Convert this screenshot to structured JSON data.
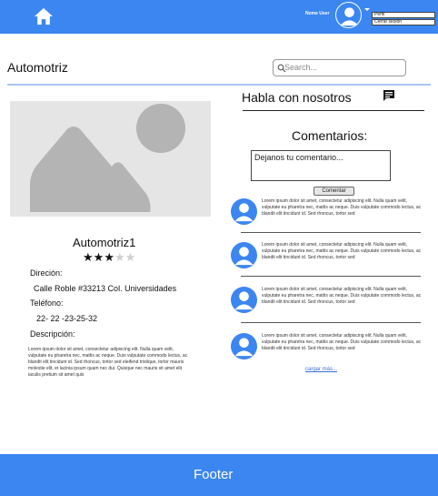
{
  "header": {
    "home_icon": "home-icon",
    "user_name": "Nome User",
    "avatar_icon": "person-icon",
    "menu": [
      "Perfil",
      "Cerrar sesión"
    ],
    "color": "#3b86f0"
  },
  "page": {
    "title": "Automotriz",
    "search_placeholder": "Search..."
  },
  "business": {
    "image_icon": "image-placeholder-icon",
    "name": "Automotriz1",
    "stars_filled": 3,
    "stars_total": 5,
    "rating_stars": "★★★★★",
    "address_label": "Direción:",
    "address": "Calle Roble #33213 Col. Universidades",
    "phone_label": "Teléfono:",
    "phone": "22- 22 -23-25-32",
    "description_label": "Descripción:",
    "description": "Lorem ipsum dolor sit amet, consectetur adipiscing elit. Nulla quam velit, vulputate eu pharetra nec, mattis ac neque. Duis vulputate commodo lectus, ac blandit elit tincidunt id. Sed rhoncus, tortor sed eleifend tristique, tortor mauris molestie elit, et lacinia ipsum quam nec dui. Quisque nec mauris sit amet elit iaculis pretium sit amet quis"
  },
  "chat": {
    "title": "Habla con nosotros",
    "icon": "chat-icon"
  },
  "comments": {
    "title": "Comentarios:",
    "input_value": "Dejanos tu comentario...",
    "button": "Comentar",
    "items": [
      {
        "text": "Lorem ipsum dolor sit amet, consectetur adipiscing elit. Nulla quam velit, vulputate eu pharetra nec, mattis ac neque. Duis vulputate commodo lectus, ac blandit elit tincidunt id. Sed rhoncus, tortor sed"
      },
      {
        "text": "Lorem ipsum dolor sit amet, consectetur adipiscing elit. Nulla quam velit, vulputate eu pharetra nec, mattis ac neque. Duis vulputate commodo lectus, ac blandit elit tincidunt id. Sed rhoncus, tortor sed"
      },
      {
        "text": "Lorem ipsum dolor sit amet, consectetur adipiscing elit. Nulla quam velit, vulputate eu pharetra nec, mattis ac neque. Duis vulputate commodo lectus, ac blandit elit tincidunt id. Sed rhoncus, tortor sed"
      },
      {
        "text": "Lorem ipsum dolor sit amet, consectetur adipiscing elit. Nulla quam velit, vulputate eu pharetra nec, mattis ac neque. Duis vulputate commodo lectus, ac blandit elit tincidunt id. Sed rhoncus, tortor sed"
      }
    ],
    "load_more": "cargar más..."
  },
  "footer": {
    "text": "Footer"
  }
}
